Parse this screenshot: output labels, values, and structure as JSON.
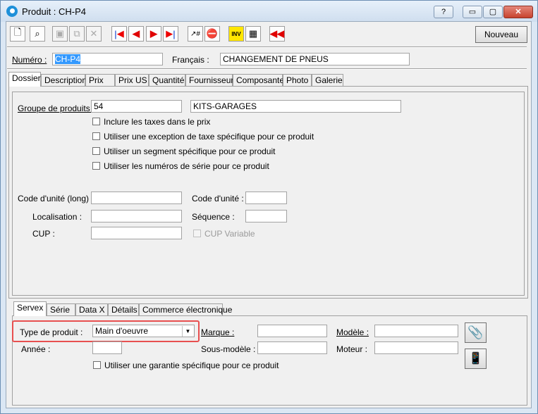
{
  "window": {
    "title": "Produit : CH-P4"
  },
  "titlebar_buttons": {
    "help": "?",
    "minimize": "▭",
    "maximize": "▢",
    "close": "✕"
  },
  "toolbar": {
    "nouveau_label": "Nouveau"
  },
  "header": {
    "numero_label": "Numéro :",
    "numero_value": "CH-P4",
    "francais_label": "Français :",
    "francais_value": "CHANGEMENT DE PNEUS"
  },
  "tabs": [
    "Dossier",
    "Description",
    "Prix",
    "Prix US",
    "Quantité",
    "Fournisseur",
    "Composante",
    "Photo",
    "Galerie"
  ],
  "dossier": {
    "groupe_label": "Groupe de produits :",
    "groupe_code": "54",
    "groupe_name": "KITS-GARAGES",
    "checkboxes": [
      "Inclure les taxes dans le prix",
      "Utiliser une exception de taxe spécifique pour ce produit",
      "Utiliser un segment spécifique pour ce produit",
      "Utiliser les numéros de série pour ce produit"
    ],
    "code_unite_long_label": "Code d'unité (long) :",
    "code_unite_label": "Code d'unité :",
    "localisation_label": "Localisation :",
    "sequence_label": "Séquence :",
    "cup_label": "CUP :",
    "cup_variable_label": "CUP Variable"
  },
  "subtabs": [
    "Servex",
    "Série",
    "Data X",
    "Détails",
    "Commerce électronique"
  ],
  "servex": {
    "type_label": "Type de produit :",
    "type_value": "Main d'oeuvre",
    "marque_label": "Marque :",
    "modele_label": "Modèle :",
    "annee_label": "Année :",
    "sous_modele_label": "Sous-modèle :",
    "moteur_label": "Moteur :",
    "garantie_label": "Utiliser une garantie spécifique pour ce produit"
  }
}
